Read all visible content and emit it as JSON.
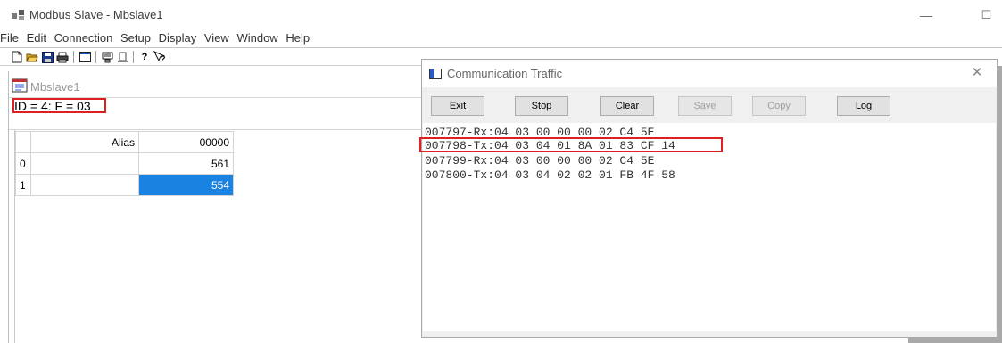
{
  "window": {
    "title": "Modbus Slave - Mbslave1",
    "minimize": "—",
    "maximize": "☐"
  },
  "menu": [
    "File",
    "Edit",
    "Connection",
    "Setup",
    "Display",
    "View",
    "Window",
    "Help"
  ],
  "toolbar": [
    "new-icon",
    "open-icon",
    "save-icon",
    "print-icon",
    "window-icon",
    "display-icon",
    "copy-icon",
    "help-icon",
    "context-help-icon"
  ],
  "child": {
    "title": "Mbslave1",
    "id_line": "ID = 4: F = 03",
    "grid": {
      "headers": [
        "Alias",
        "00000"
      ],
      "rows": [
        {
          "index": "0",
          "alias": "",
          "value": "561",
          "selected": false
        },
        {
          "index": "1",
          "alias": "",
          "value": "554",
          "selected": true
        }
      ]
    }
  },
  "traffic": {
    "title": "Communication Traffic",
    "close": "✕",
    "buttons": [
      {
        "label": "Exit",
        "enabled": true
      },
      {
        "label": "Stop",
        "enabled": true
      },
      {
        "label": "Clear",
        "enabled": true
      },
      {
        "label": "Save",
        "enabled": false
      },
      {
        "label": "Copy",
        "enabled": false
      },
      {
        "label": "Log",
        "enabled": true
      }
    ],
    "log": [
      "007797-Rx:04 03 00 00 00 02 C4 5E",
      "007798-Tx:04 03 04 01 8A 01 83 CF 14",
      "007799-Rx:04 03 00 00 00 02 C4 5E",
      "007800-Tx:04 03 04 02 02 01 FB 4F 58"
    ]
  }
}
